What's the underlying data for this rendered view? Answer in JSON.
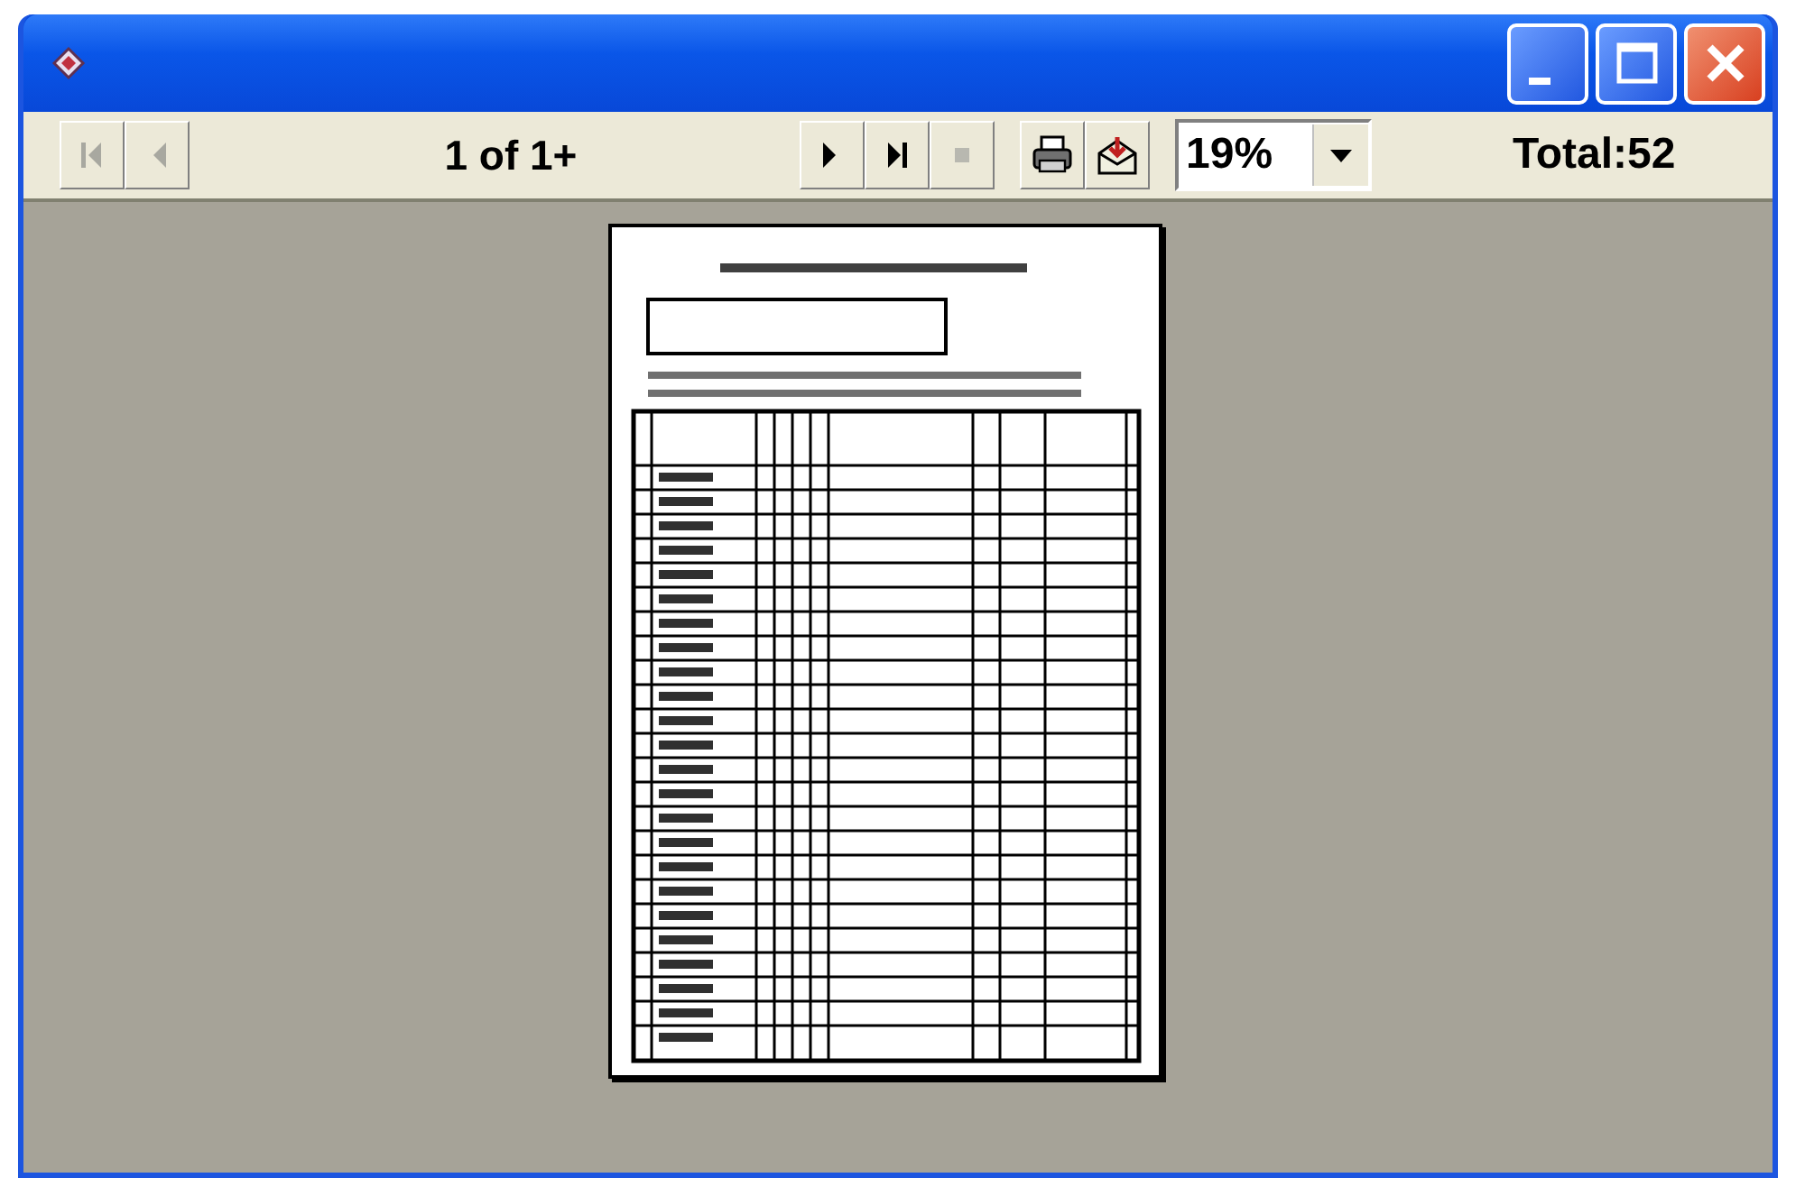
{
  "window": {
    "controls": [
      {
        "kind": "minimize"
      },
      {
        "kind": "maximize"
      },
      {
        "kind": "close"
      }
    ]
  },
  "toolbar": {
    "nav_buttons": [
      {
        "kind": "first",
        "disabled": true
      },
      {
        "kind": "previous",
        "disabled": true
      }
    ],
    "page_indicator": "1 of 1+",
    "nav_buttons_right": [
      {
        "kind": "next",
        "disabled": false
      },
      {
        "kind": "last",
        "disabled": false
      },
      {
        "kind": "stop",
        "disabled": true
      }
    ],
    "action_buttons": [
      {
        "kind": "print"
      },
      {
        "kind": "export"
      }
    ],
    "zoom": {
      "value": "19%"
    },
    "total": "Total:52"
  }
}
